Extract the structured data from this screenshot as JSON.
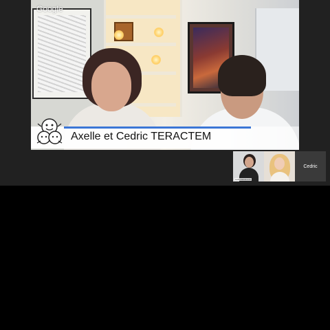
{
  "app": {
    "watermark": "Google"
  },
  "main_video": {
    "caption": "Axelle et Cedric TERACTEM",
    "accent_color": "#3b76d6"
  },
  "participants": [
    {
      "name": "",
      "label": "Leah Rafeikovich",
      "active": false
    },
    {
      "name": "",
      "label": "",
      "active": false
    },
    {
      "name": "Cedric",
      "label": "",
      "active": false
    }
  ],
  "icons": {
    "mascot": "teractem-logo-icon"
  }
}
